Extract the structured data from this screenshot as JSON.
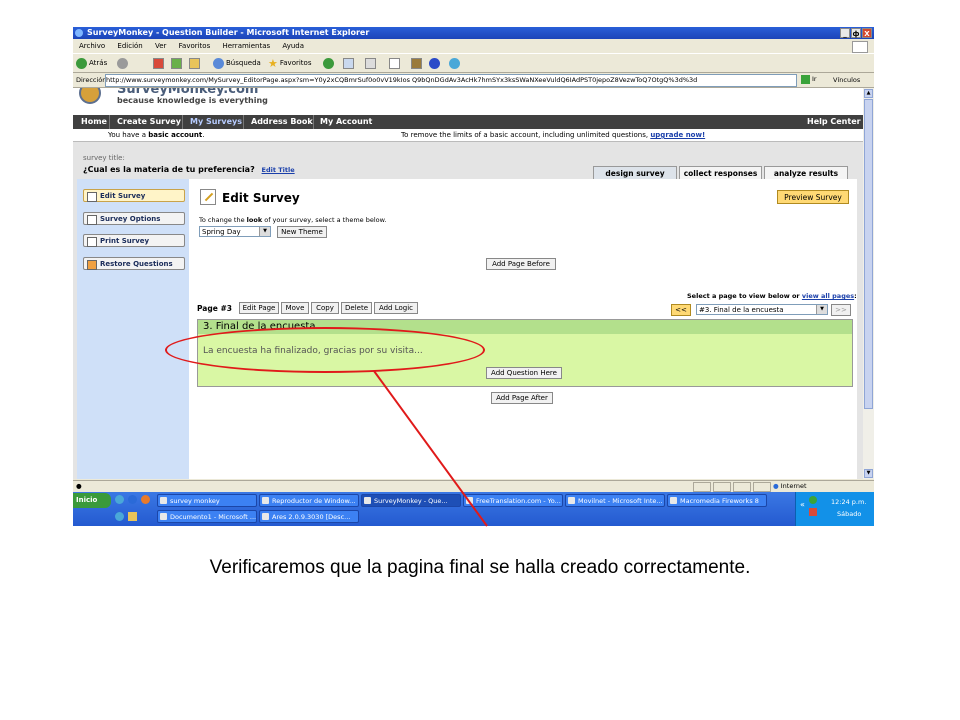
{
  "window": {
    "title": "SurveyMonkey - Question Builder - Microsoft Internet Explorer",
    "buttons": [
      "_",
      "ф",
      "X"
    ]
  },
  "menu": [
    "Archivo",
    "Edición",
    "Ver",
    "Favoritos",
    "Herramientas",
    "Ayuda"
  ],
  "toolbar": {
    "back": "Atrás",
    "search": "Búsqueda",
    "favorites": "Favoritos"
  },
  "address": {
    "label": "Dirección",
    "url": "http://www.surveymonkey.com/MySurvey_EditorPage.aspx?sm=Y0y2xCQBmrSuf0o0vV19kIos Q9bQnDGdAv3AcHk7hmSYx3ksSWaNXeeVuldQ6IAdPST0jepoZ8VezwToQ7OtgQ%3d%3d",
    "go": "Ir",
    "links": "Vínculos"
  },
  "site": {
    "logo_text": "SurveyMonkey.com",
    "tagline": "because knowledge is everything",
    "nav": [
      "Home",
      "Create Survey",
      "My Surveys",
      "Address Book",
      "My Account"
    ],
    "help": "Help Center",
    "basic_left": "You have a",
    "basic_bold": "basic account",
    "basic_right": "To remove the limits of a basic account, including unlimited questions,",
    "upgrade": "upgrade now!",
    "survey_title_label": "survey title:",
    "survey_title": "¿Cual es la materia de tu preferencia?",
    "edit_title": "Edit Title",
    "tabs": [
      "design survey",
      "collect responses",
      "analyze results"
    ]
  },
  "sidebar": {
    "items": [
      "Edit Survey",
      "Survey Options",
      "Print Survey",
      "Restore Questions"
    ]
  },
  "editor": {
    "heading": "Edit Survey",
    "preview": "Preview Survey",
    "theme_prefix": "To change the",
    "theme_bold": "look",
    "theme_suffix": "of your survey, select a theme below.",
    "theme_value": "Spring Day",
    "new_theme": "New Theme",
    "add_page_before": "Add Page Before",
    "page_label": "Page",
    "page_num": "#3",
    "page_buttons": [
      "Edit Page",
      "Move",
      "Copy",
      "Delete",
      "Add Logic"
    ],
    "select_page_text": "Select a page to view below or",
    "view_all": "view all pages",
    "prev": "<<",
    "next": ">>",
    "page_select": "#3. Final de la encuesta",
    "page_header": "3. Final de la encuesta",
    "page_message": "La encuesta ha finalizado, gracias por su visita...",
    "add_question": "Add Question Here",
    "add_page_after": "Add Page After"
  },
  "status": {
    "zone": "Internet"
  },
  "taskbar": {
    "start": "Inicio",
    "tasks_row1": [
      "survey monkey",
      "Reproductor de Window...",
      "SurveyMonkey - Que...",
      "FreeTranslation.com - Yo...",
      "Movilnet - Microsoft Inte...",
      "Macromedia Fireworks 8"
    ],
    "tasks_row2": [
      "Documento1 - Microsoft ...",
      "Ares 2.0.9.3030  [Desc..."
    ],
    "time": "12:24 p.m.",
    "day": "Sábado"
  },
  "caption": "Verificaremos que la pagina final se halla creado correctamente.",
  "colors": {
    "annotation": "#e01a1a",
    "page_green": "#d9f7a4",
    "page_header_green": "#b3e08c"
  }
}
